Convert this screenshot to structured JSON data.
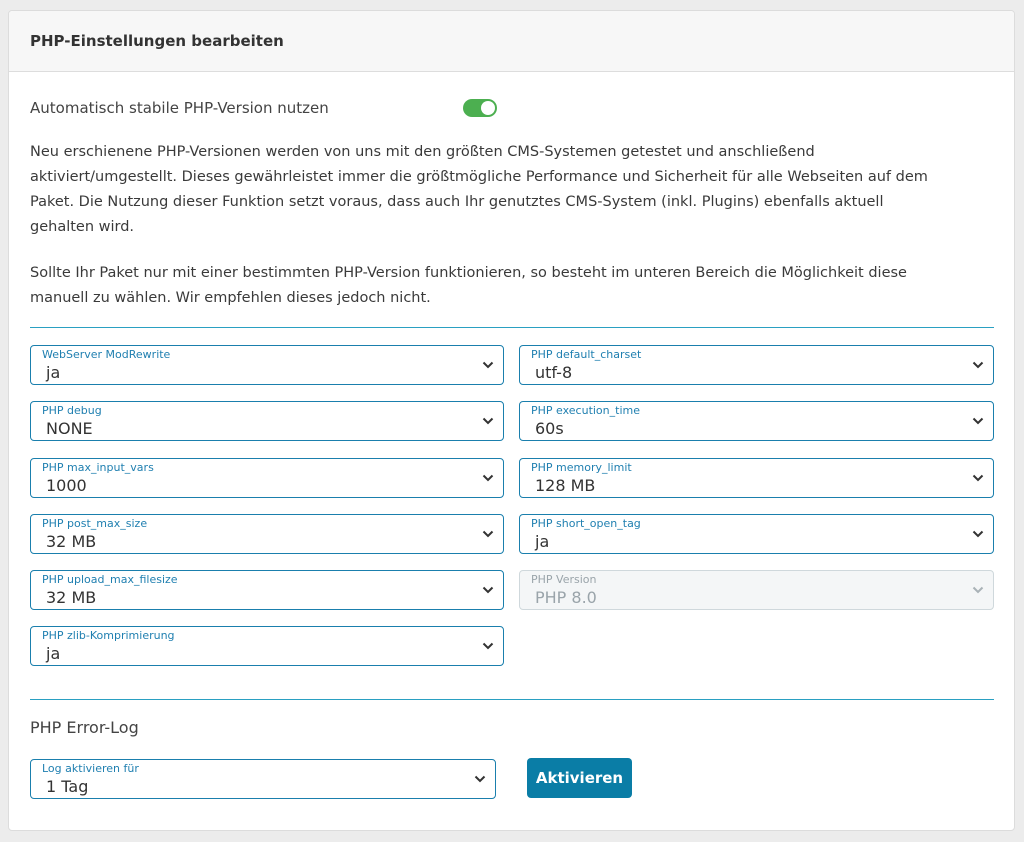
{
  "header": {
    "title": "PHP-Einstellungen bearbeiten"
  },
  "auto_stable": {
    "label": "Automatisch stabile PHP-Version nutzen",
    "enabled": true,
    "color": "#4caf50"
  },
  "paragraphs": {
    "p1_line1": "Neu erschienene PHP-Versionen werden von uns mit den größten CMS-Systemen getestet und anschließend",
    "p1_line2": "aktiviert/umgestellt. Dieses gewährleistet immer die größtmögliche Performance und Sicherheit für alle Webseiten auf dem",
    "p1_line3": "Paket. Die Nutzung dieser Funktion setzt voraus, dass auch Ihr genutztes CMS-System (inkl. Plugins) ebenfalls aktuell",
    "p1_line4": "gehalten wird.",
    "p2_line1": "Sollte Ihr Paket nur mit einer bestimmten PHP-Version funktionieren, so besteht im unteren Bereich die Möglichkeit diese",
    "p2_line2": "manuell zu wählen. Wir empfehlen dieses jedoch nicht."
  },
  "fields": {
    "modrewrite": {
      "label": "WebServer ModRewrite",
      "value": "ja"
    },
    "charset": {
      "label": "PHP default_charset",
      "value": "utf-8"
    },
    "debug": {
      "label": "PHP debug",
      "value": "NONE"
    },
    "execution_time": {
      "label": "PHP execution_time",
      "value": "60s"
    },
    "max_input_vars": {
      "label": "PHP max_input_vars",
      "value": "1000"
    },
    "memory_limit": {
      "label": "PHP memory_limit",
      "value": "128 MB"
    },
    "post_max_size": {
      "label": "PHP post_max_size",
      "value": "32 MB"
    },
    "short_open_tag": {
      "label": "PHP short_open_tag",
      "value": "ja"
    },
    "upload_max_filesize": {
      "label": "PHP upload_max_filesize",
      "value": "32 MB"
    },
    "php_version": {
      "label": "PHP Version",
      "value": "PHP 8.0",
      "disabled": true
    },
    "zlib": {
      "label": "PHP zlib-Komprimierung",
      "value": "ja"
    }
  },
  "error_log": {
    "title": "PHP Error-Log",
    "field": {
      "label": "Log aktivieren für",
      "value": "1 Tag"
    },
    "button_label": "Aktivieren"
  },
  "colors": {
    "accent": "#0a7da6",
    "field_border": "#1a7fad",
    "divider": "#2aa0c2"
  }
}
